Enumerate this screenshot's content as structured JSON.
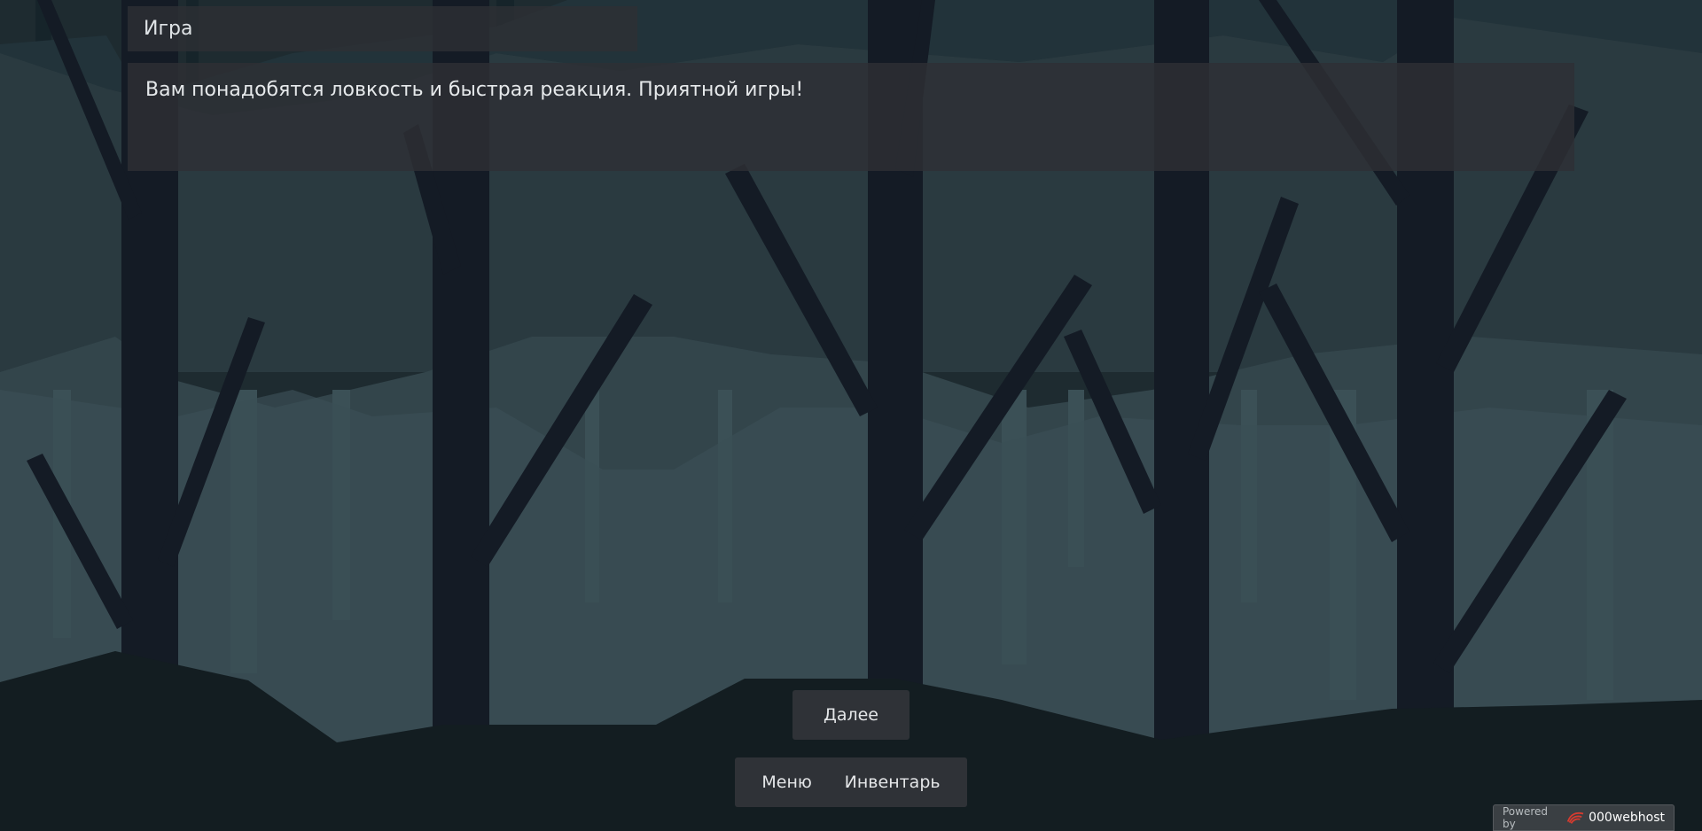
{
  "game": {
    "title": "Игра",
    "dialog_text": "Вам понадобятся ловкость и быстрая реакция. Приятной игры!"
  },
  "buttons": {
    "next_label": "Далее",
    "menu_label": "Меню",
    "inventory_label": "Инвентарь"
  },
  "footer": {
    "powered_by": "Powered by",
    "brand": "000webhost"
  },
  "scene": {
    "description_icon": "forest-background",
    "colors": {
      "sky_top": "#1c2a2e",
      "fog_mid": "#2f3d42",
      "fog_low": "#3a4e54",
      "trunk": "#141b25",
      "ground": "#131d21",
      "panel": "#2f3237"
    }
  }
}
